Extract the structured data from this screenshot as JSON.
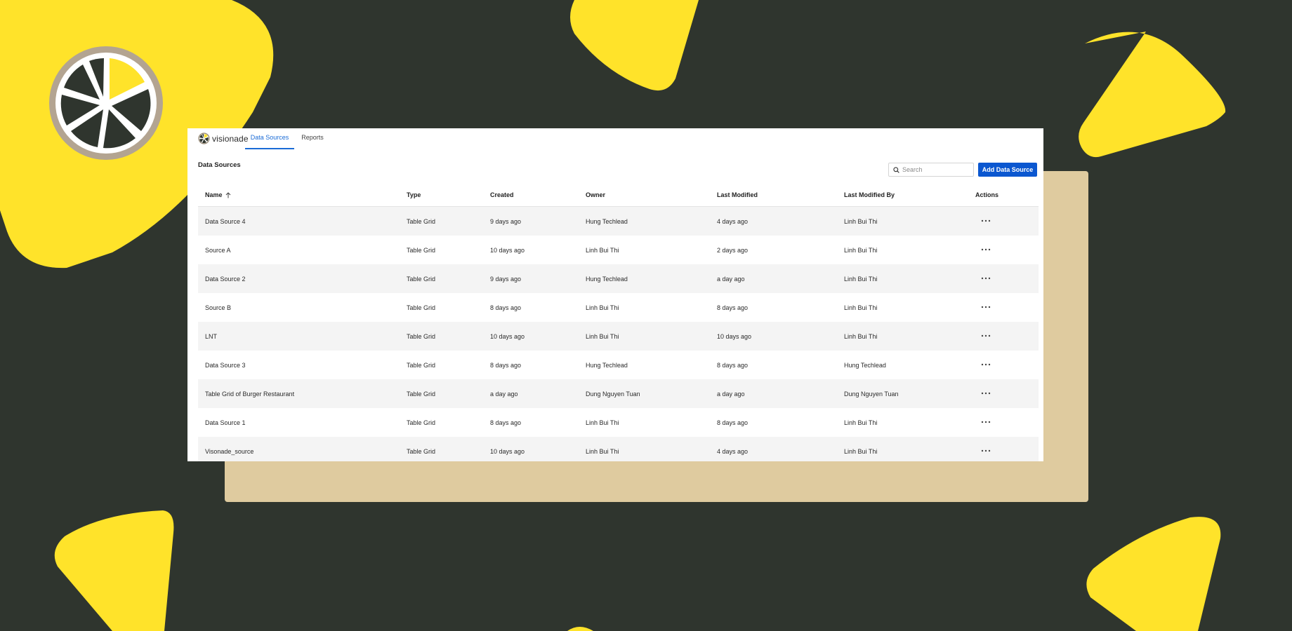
{
  "app": {
    "brand": "visionade",
    "tabs": [
      {
        "label": "Data Sources",
        "active": true
      },
      {
        "label": "Reports",
        "active": false
      }
    ]
  },
  "main": {
    "title": "Data Sources",
    "search_placeholder": "Search",
    "search_value": "",
    "add_button_label": "Add Data Source"
  },
  "table": {
    "columns": [
      "Name",
      "Type",
      "Created",
      "Owner",
      "Last Modified",
      "Last Modified By",
      "Actions"
    ],
    "sort": {
      "column": "Name",
      "direction": "ascending"
    },
    "rows": [
      {
        "name": "Data Source 4",
        "type": "Table Grid",
        "created": "9 days ago",
        "owner": "Hung Techlead",
        "last_modified": "4 days ago",
        "last_modified_by": "Linh Bui Thi"
      },
      {
        "name": "Source A",
        "type": "Table Grid",
        "created": "10 days ago",
        "owner": "Linh Bui Thi",
        "last_modified": "2 days ago",
        "last_modified_by": "Linh Bui Thi"
      },
      {
        "name": "Data Source 2",
        "type": "Table Grid",
        "created": "9 days ago",
        "owner": "Hung Techlead",
        "last_modified": "a day ago",
        "last_modified_by": "Linh Bui Thi"
      },
      {
        "name": "Source B",
        "type": "Table Grid",
        "created": "8 days ago",
        "owner": "Linh Bui Thi",
        "last_modified": "8 days ago",
        "last_modified_by": "Linh Bui Thi"
      },
      {
        "name": "LNT",
        "type": "Table Grid",
        "created": "10 days ago",
        "owner": "Linh Bui Thi",
        "last_modified": "10 days ago",
        "last_modified_by": "Linh Bui Thi"
      },
      {
        "name": "Data Source 3",
        "type": "Table Grid",
        "created": "8 days ago",
        "owner": "Hung Techlead",
        "last_modified": "8 days ago",
        "last_modified_by": "Hung Techlead"
      },
      {
        "name": "Table Grid of Burger Restaurant",
        "type": "Table Grid",
        "created": "a day ago",
        "owner": "Dung Nguyen Tuan",
        "last_modified": "a day ago",
        "last_modified_by": "Dung Nguyen Tuan"
      },
      {
        "name": "Data Source 1",
        "type": "Table Grid",
        "created": "8 days ago",
        "owner": "Linh Bui Thi",
        "last_modified": "8 days ago",
        "last_modified_by": "Linh Bui Thi"
      },
      {
        "name": "Visonade_source",
        "type": "Table Grid",
        "created": "10 days ago",
        "owner": "Linh Bui Thi",
        "last_modified": "4 days ago",
        "last_modified_by": "Linh Bui Thi"
      }
    ]
  },
  "colors": {
    "background": "#2f352e",
    "yellow_shape": "#ffe32a",
    "tan_card": "#dfcb9f",
    "accent_blue": "#0b57d0",
    "tab_active": "#1a6bd6",
    "row_alt": "#f4f4f4"
  },
  "icons": {
    "brand_logo": "lemon-slice-icon",
    "decor_logo": "lemon-slice-icon",
    "search": "search-icon",
    "sort": "arrow-up-icon",
    "row_action": "more-horizontal-icon"
  }
}
